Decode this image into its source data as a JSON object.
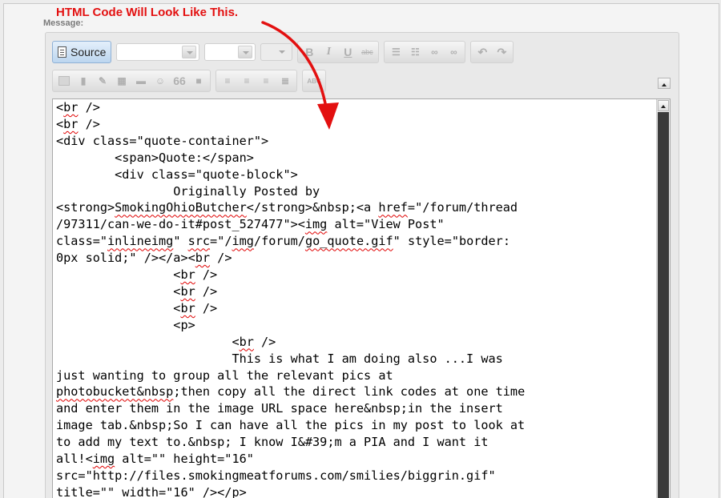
{
  "annotation": {
    "text": "HTML Code Will Look Like This."
  },
  "form": {
    "message_label": "Message:"
  },
  "toolbar": {
    "source_label": "Source",
    "bold": "B",
    "italic": "I",
    "underline": "U",
    "strike": "abc",
    "quote": "66",
    "spell": "ABC"
  },
  "editor": {
    "lines": [
      [
        "<",
        {
          "s": "br"
        },
        " />"
      ],
      [
        "<",
        {
          "s": "br"
        },
        " />"
      ],
      [
        "<div class=\"quote-container\">"
      ],
      [
        "        <span>Quote:</span>"
      ],
      [
        "        <div class=\"quote-block\">"
      ],
      [
        "                Originally Posted by"
      ],
      [
        "<strong>",
        {
          "s": "SmokingOhioButcher"
        },
        "</strong>&nbsp;<a ",
        {
          "s": "href"
        },
        "=\"/forum/thread"
      ],
      [
        "/97311/can-we-do-it#post_527477\"><",
        {
          "s": "img"
        },
        " alt=\"View Post\""
      ],
      [
        "class=\"",
        {
          "s": "inlineimg"
        },
        "\" ",
        {
          "s": "src"
        },
        "=\"/",
        {
          "s": "img"
        },
        "/forum/",
        {
          "s": "go_quote.gif"
        },
        "\" style=\"border:"
      ],
      [
        "0px solid;\" /></a><",
        {
          "s": "br"
        },
        " />"
      ],
      [
        "                <",
        {
          "s": "br"
        },
        " />"
      ],
      [
        "                <",
        {
          "s": "br"
        },
        " />"
      ],
      [
        "                <",
        {
          "s": "br"
        },
        " />"
      ],
      [
        "                <p>"
      ],
      [
        "                        <",
        {
          "s": "br"
        },
        " />"
      ],
      [
        "                        This is what I am doing also ...I was"
      ],
      [
        "just wanting to group all the relevant pics at"
      ],
      [
        {
          "s": "photobucket&nbsp"
        },
        ";then copy all the direct link codes at one time"
      ],
      [
        "and enter them in the image URL space here&nbsp;in the insert"
      ],
      [
        "image tab.&nbsp;So I can have all the pics in my post to look at"
      ],
      [
        "to add my text to.&nbsp; I know I&#39;m a PIA and I want it"
      ],
      [
        "all!<",
        {
          "s": "img"
        },
        " alt=\"\" height=\"16\""
      ],
      [
        "src=\"http://files.smokingmeatforums.com/smilies/biggrin.gif\""
      ],
      [
        "title=\"\" width=\"16\" /></p>"
      ]
    ]
  },
  "colors": {
    "annotation": "#e31010",
    "spellcheck": "#e00000",
    "source_button": "#bcd6ef"
  }
}
